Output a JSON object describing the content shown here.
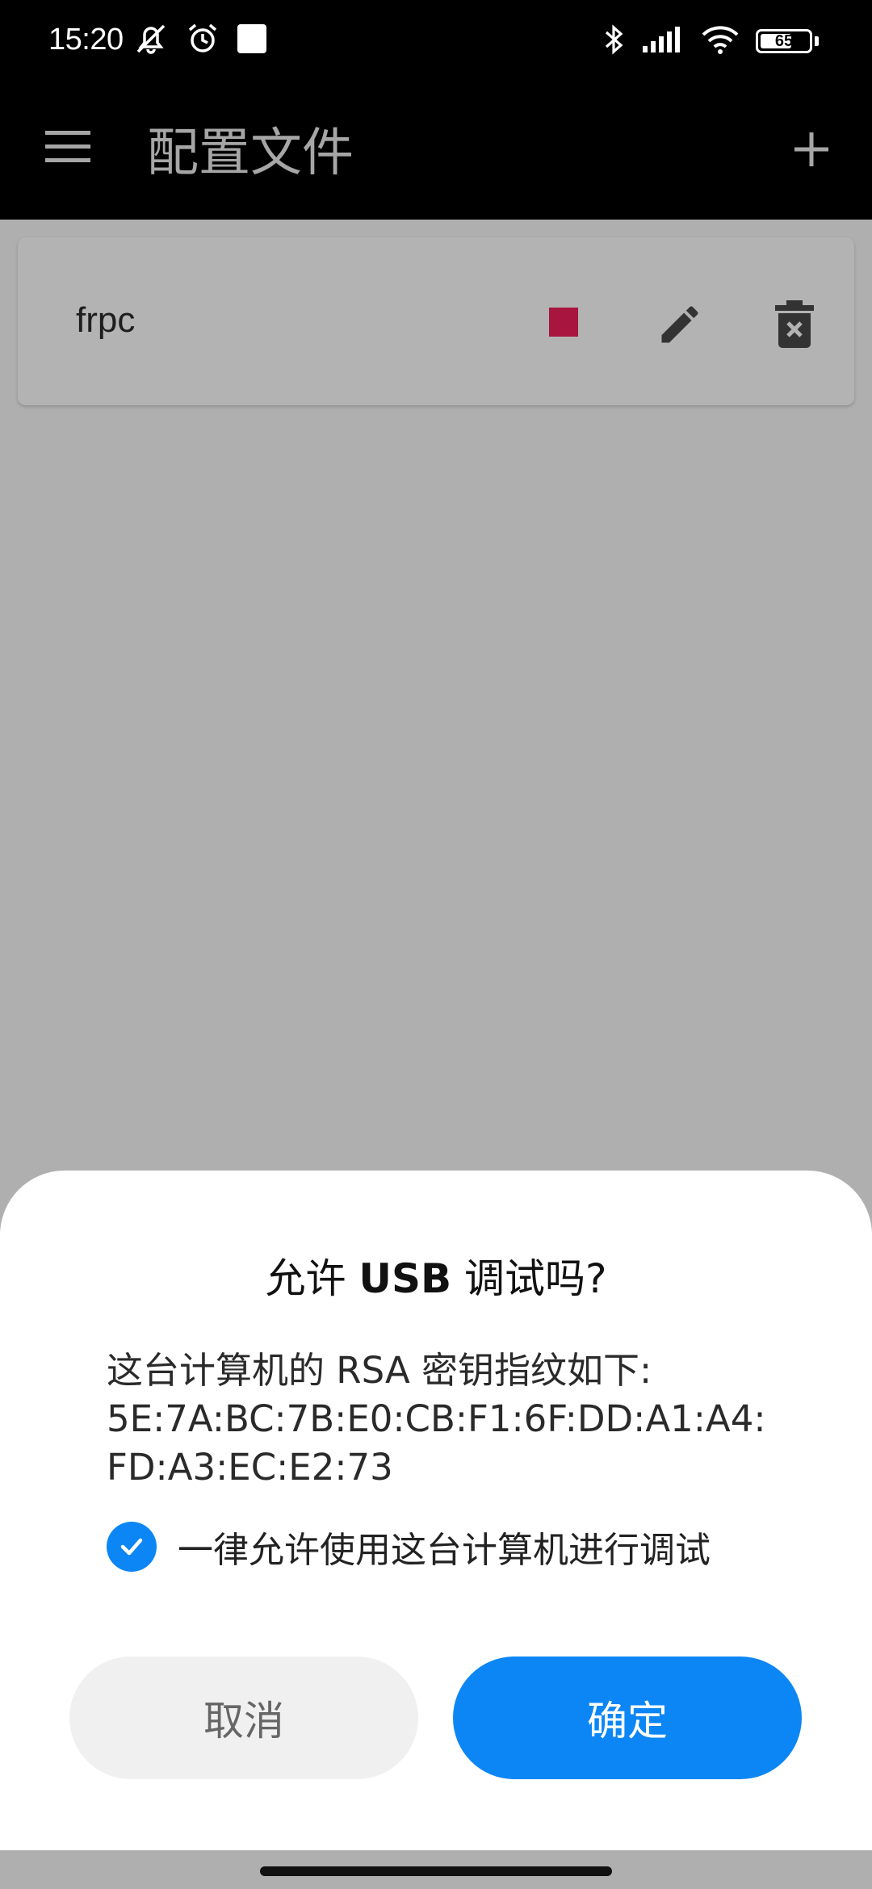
{
  "status_bar": {
    "time": "15:20",
    "battery": "65",
    "battery_level": 0.65,
    "icons": [
      "silent-icon",
      "alarm-icon",
      "notification-square-icon",
      "bluetooth-icon",
      "signal-icon",
      "wifi-icon",
      "battery-icon"
    ]
  },
  "app_bar": {
    "title": "配置文件",
    "menu_icon": "menu-icon",
    "add_icon": "add-icon"
  },
  "profiles": [
    {
      "name": "frpc",
      "status_color": "#a8153f",
      "actions": [
        "stop-icon",
        "edit-icon",
        "delete-icon"
      ]
    }
  ],
  "dialog": {
    "title_prefix": "允许 ",
    "title_bold": "USB",
    "title_suffix": " 调试吗?",
    "message_lines": [
      "这台计算机的 RSA 密钥指纹如下:",
      "5E:7A:BC:7B:E0:CB:F1:6F:DD:A1:A4:",
      "FD:A3:EC:E2:73"
    ],
    "checkbox_label": "一律允许使用这台计算机进行调试",
    "checkbox_checked": true,
    "cancel_label": "取消",
    "ok_label": "确定"
  },
  "colors": {
    "accent": "#0c86f5",
    "scrim": "#b0afb0",
    "stop": "#a8153f"
  }
}
